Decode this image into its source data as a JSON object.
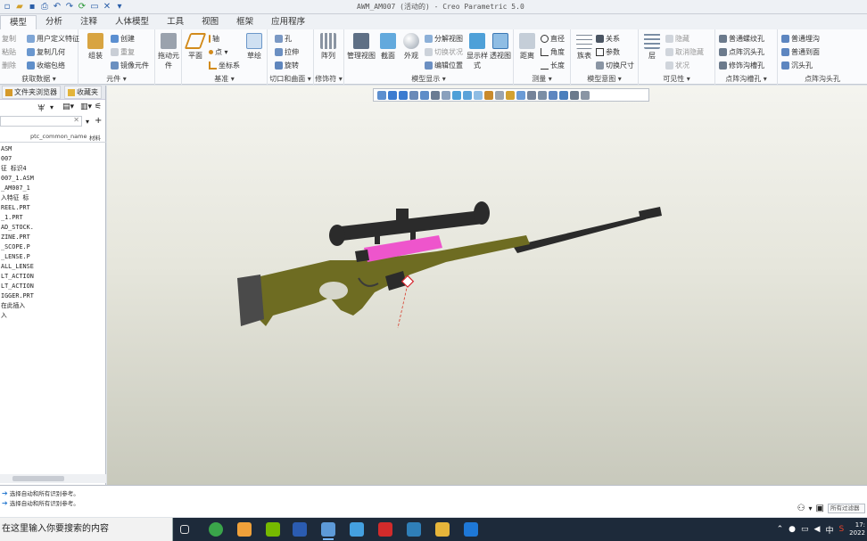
{
  "window": {
    "title": "AWM_AM007 (活动的) - Creo Parametric 5.0"
  },
  "ribbon": {
    "tabs": [
      "模型",
      "分析",
      "注释",
      "人体模型",
      "工具",
      "视图",
      "框架",
      "应用程序"
    ],
    "active_tab": "模型",
    "groups": [
      {
        "label": "获取数据 ▾",
        "buttons": [
          "用户定义特征",
          "复制几何",
          "收缩包络"
        ],
        "prefixes": [
          "复制",
          "粘贴",
          "删除"
        ]
      },
      {
        "label": "元件 ▾",
        "buttons": [
          "组装",
          "创建",
          "重复",
          "镜像元件"
        ]
      },
      {
        "label": "",
        "buttons": [
          "拖动元件"
        ]
      },
      {
        "label": "基准 ▾",
        "buttons": [
          "平面",
          "轴",
          "点 ▾",
          "坐标系",
          "草绘"
        ]
      },
      {
        "label": "切口和曲面 ▾",
        "buttons": [
          "孔",
          "拉伸",
          "旋转"
        ]
      },
      {
        "label": "修饰符 ▾",
        "buttons": [
          "阵列"
        ]
      },
      {
        "label": "模型显示 ▾",
        "buttons": [
          "管理视图",
          "截面",
          "外观",
          "分解视图",
          "切换状况",
          "编辑位置",
          "显示样式",
          "透视图"
        ]
      },
      {
        "label": "测量 ▾",
        "buttons": [
          "距离",
          "直径",
          "角度",
          "长度"
        ]
      },
      {
        "label": "模型意图 ▾",
        "buttons": [
          "族表",
          "关系",
          "参数",
          "切换尺寸"
        ]
      },
      {
        "label": "可见性 ▾",
        "buttons": [
          "层",
          "隐藏",
          "取消隐藏",
          "状况"
        ]
      },
      {
        "label": "点阵沟槽孔 ▾",
        "buttons": [
          "普通螺纹孔",
          "点阵沉头孔",
          "修饰沟槽孔"
        ]
      },
      {
        "label": "点阵沟头孔",
        "buttons": [
          "普通埋沟",
          "普通到面",
          "沉头孔"
        ]
      }
    ]
  },
  "left_panel": {
    "tabs": [
      "文件夹浏览器",
      "收藏夹"
    ],
    "columns": [
      "ptc_common_name",
      "材料"
    ],
    "tree": [
      "ASM",
      "007",
      "征  标识4",
      "007_1.ASM",
      "_AM007_1",
      "入特征  标",
      "REEL.PRT",
      "_1.PRT",
      "AD_STOCK.",
      "ZINE.PRT",
      "_SCOPE.P",
      "_LENSE.P",
      "ALL_LENSE",
      "LT_ACTION",
      "LT_ACTION",
      "IGGER.PRT",
      "在此插入",
      "入"
    ]
  },
  "messages": [
    "选择自动和所有识别参考。",
    "选择自动和所有识别参考。"
  ],
  "filter_label": "所有过滤器",
  "taskbar": {
    "search_placeholder": "在这里输入你要搜索的内容",
    "ime": "中",
    "time": "17:",
    "date": "2022"
  },
  "colors": {
    "stock": "#6e6c22",
    "stock_dark": "#4d4b14",
    "metal": "#2b2b2b",
    "selected": "#ee55cc",
    "butt": "#4a4a4a"
  }
}
